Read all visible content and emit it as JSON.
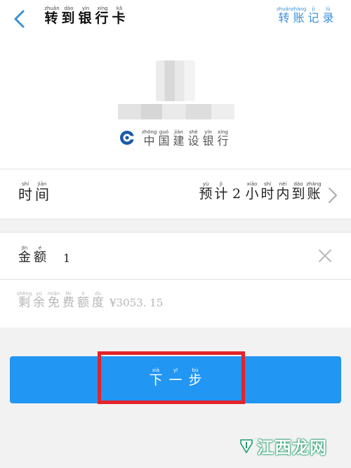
{
  "header": {
    "title": [
      {
        "py": "zhuǎn",
        "ch": "转"
      },
      {
        "py": "dào",
        "ch": "到"
      },
      {
        "py": "yín",
        "ch": "银"
      },
      {
        "py": "xíng",
        "ch": "行"
      },
      {
        "py": "kǎ",
        "ch": "卡"
      }
    ],
    "records_link": [
      {
        "py": "zhuǎn",
        "ch": "转"
      },
      {
        "py": "zhàng",
        "ch": "账"
      },
      {
        "py": "jì",
        "ch": "记"
      },
      {
        "py": "lù",
        "ch": "录"
      }
    ],
    "icons": {
      "back": "chevron-left-icon"
    }
  },
  "recipient": {
    "bank_name": [
      {
        "py": "zhōng",
        "ch": "中"
      },
      {
        "py": "guó",
        "ch": "国"
      },
      {
        "py": "jiàn",
        "ch": "建"
      },
      {
        "py": "shè",
        "ch": "设"
      },
      {
        "py": "yín",
        "ch": "银"
      },
      {
        "py": "xíng",
        "ch": "行"
      }
    ],
    "bank_logo_color": "#1d5aa8"
  },
  "time_row": {
    "label": [
      {
        "py": "shí",
        "ch": "时"
      },
      {
        "py": "jiān",
        "ch": "间"
      }
    ],
    "value": [
      {
        "py": "yù",
        "ch": "预"
      },
      {
        "py": "jì",
        "ch": "计"
      },
      {
        "py": "",
        "ch": "2"
      },
      {
        "py": "xiǎo",
        "ch": "小"
      },
      {
        "py": "shí",
        "ch": "时"
      },
      {
        "py": "nèi",
        "ch": "内"
      },
      {
        "py": "dào",
        "ch": "到"
      },
      {
        "py": "zhàng",
        "ch": "账"
      }
    ],
    "icons": {
      "chevron": "chevron-right-icon"
    }
  },
  "amount_row": {
    "label": [
      {
        "py": "jīn",
        "ch": "金"
      },
      {
        "py": "é",
        "ch": "额"
      }
    ],
    "value": "1",
    "icons": {
      "clear": "clear-icon"
    }
  },
  "free_quota": {
    "label": [
      {
        "py": "shèng",
        "ch": "剩"
      },
      {
        "py": "yú",
        "ch": "余"
      },
      {
        "py": "miǎn",
        "ch": "免"
      },
      {
        "py": "fèi",
        "ch": "费"
      },
      {
        "py": "é",
        "ch": "额"
      },
      {
        "py": "dù",
        "ch": "度"
      }
    ],
    "value": "¥3053. 15"
  },
  "next_button": {
    "label": [
      {
        "py": "xià",
        "ch": "下"
      },
      {
        "py": "yī",
        "ch": "一"
      },
      {
        "py": "bù",
        "ch": "步"
      }
    ]
  },
  "watermark": {
    "text": "江西龙网"
  },
  "colors": {
    "accent": "#3a8fd9",
    "button": "#2196f3",
    "highlight": "#e3232a",
    "muted_text": "#b5b5b5"
  }
}
